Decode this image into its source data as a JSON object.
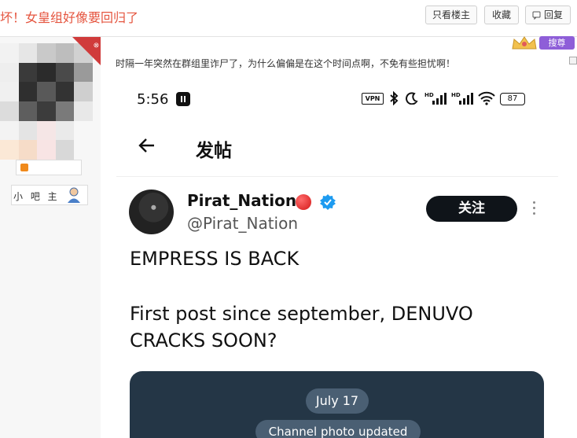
{
  "thread": {
    "title": "坏！女皇组好像要回归了",
    "buttons": {
      "only_op": "只看楼主",
      "favorite": "收藏",
      "reply": "回复"
    }
  },
  "sidebar": {
    "owner_label": "小 吧 主"
  },
  "post": {
    "text": "时隔一年突然在群组里诈尸了，为什么偏偏是在这个时间点啊，不免有些担忧啊！",
    "badge": "搜尊"
  },
  "screenshot": {
    "status_bar": {
      "time": "5:56",
      "vpn": "VPN",
      "battery": "87"
    },
    "app_bar": {
      "title": "发帖"
    },
    "tweet": {
      "display_name": "Pirat_Nation",
      "handle": "@Pirat_Nation",
      "follow_label": "关注",
      "line1": "EMPRESS IS BACK",
      "line2a": "First post since september, DENUVO",
      "line2b": "CRACKS SOON?",
      "media": {
        "date": "July 17",
        "caption": "Channel photo updated"
      }
    }
  },
  "colors": {
    "title_red": "#e5553f",
    "badge_purple": "#8e5ed8",
    "verified_blue": "#1d9bf0",
    "media_bg": "#243646"
  }
}
